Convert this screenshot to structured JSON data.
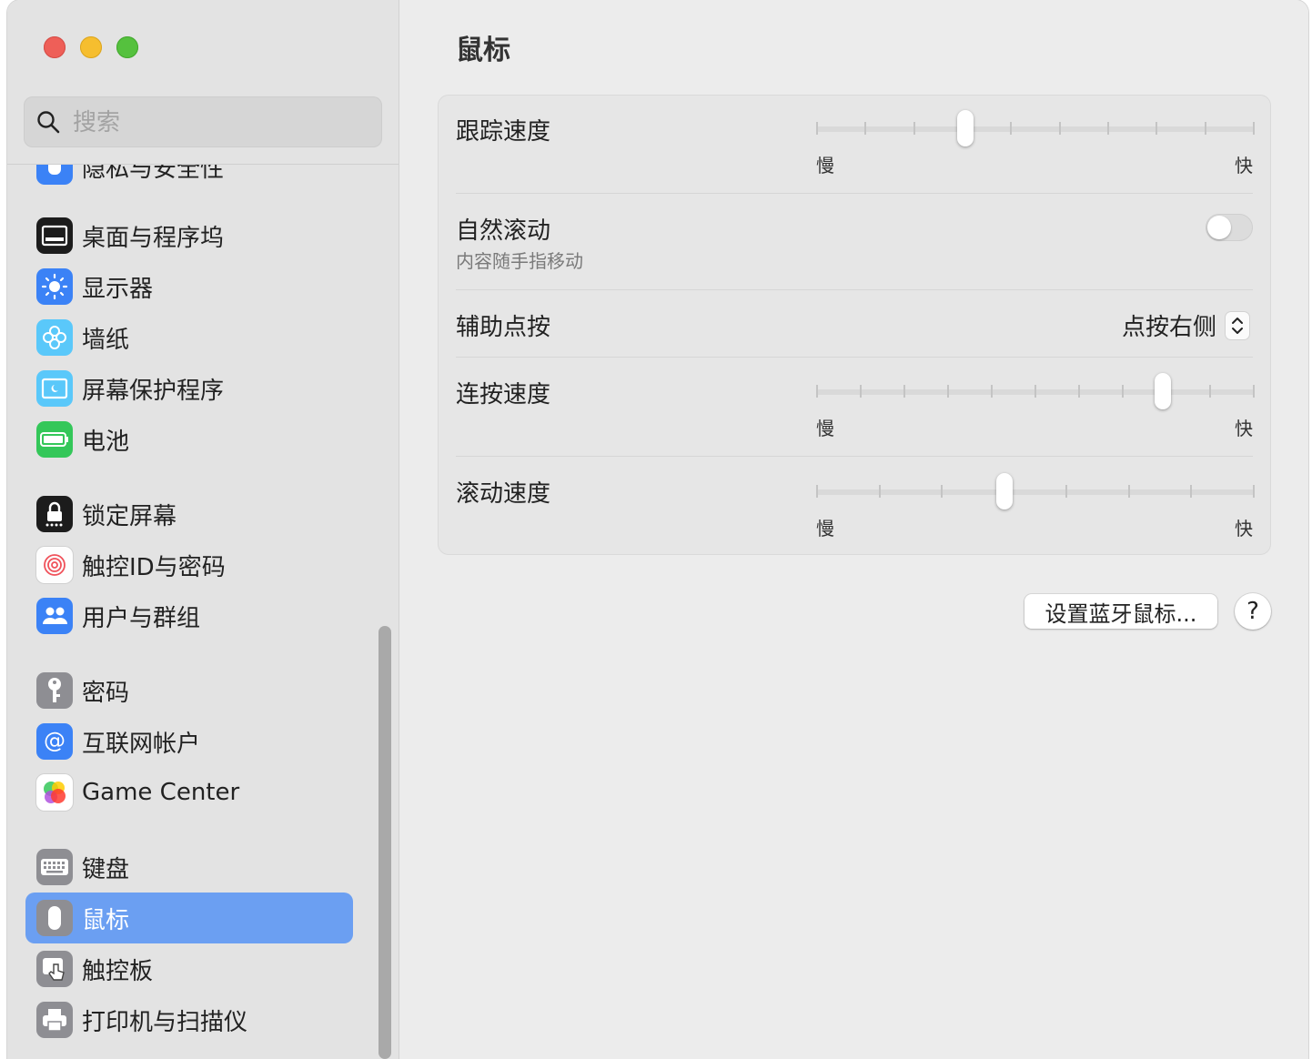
{
  "window": {
    "title": "鼠标"
  },
  "search": {
    "placeholder": "搜索",
    "value": ""
  },
  "sidebar": {
    "items": [
      {
        "label": "隐私与安全性",
        "icon": "hand-icon"
      },
      {
        "label": "桌面与程序坞",
        "icon": "dock-icon"
      },
      {
        "label": "显示器",
        "icon": "sun-icon"
      },
      {
        "label": "墙纸",
        "icon": "flower-icon"
      },
      {
        "label": "屏幕保护程序",
        "icon": "screensaver-icon"
      },
      {
        "label": "电池",
        "icon": "battery-icon"
      },
      {
        "label": "锁定屏幕",
        "icon": "lock-icon"
      },
      {
        "label": "触控ID与密码",
        "icon": "fingerprint-icon"
      },
      {
        "label": "用户与群组",
        "icon": "users-icon"
      },
      {
        "label": "密码",
        "icon": "key-icon"
      },
      {
        "label": "互联网帐户",
        "icon": "at-icon"
      },
      {
        "label": "Game Center",
        "icon": "game-center-icon"
      },
      {
        "label": "键盘",
        "icon": "keyboard-icon"
      },
      {
        "label": "鼠标",
        "icon": "mouse-icon",
        "selected": true
      },
      {
        "label": "触控板",
        "icon": "trackpad-icon"
      },
      {
        "label": "打印机与扫描仪",
        "icon": "printer-icon"
      }
    ]
  },
  "settings": {
    "tracking": {
      "label": "跟踪速度",
      "slow": "慢",
      "fast": "快",
      "ticks": 10,
      "value": 0.34
    },
    "natural_scroll": {
      "label": "自然滚动",
      "sub": "内容随手指移动",
      "on": false
    },
    "secondary_click": {
      "label": "辅助点按",
      "value": "点按右侧"
    },
    "double_click": {
      "label": "连按速度",
      "slow": "慢",
      "fast": "快",
      "ticks": 11,
      "value": 0.79
    },
    "scroll_speed": {
      "label": "滚动速度",
      "slow": "慢",
      "fast": "快",
      "ticks": 8,
      "value": 0.43
    }
  },
  "buttons": {
    "bluetooth": "设置蓝牙鼠标...",
    "help": "?"
  },
  "colors": {
    "accent": "#6b9ff2"
  }
}
